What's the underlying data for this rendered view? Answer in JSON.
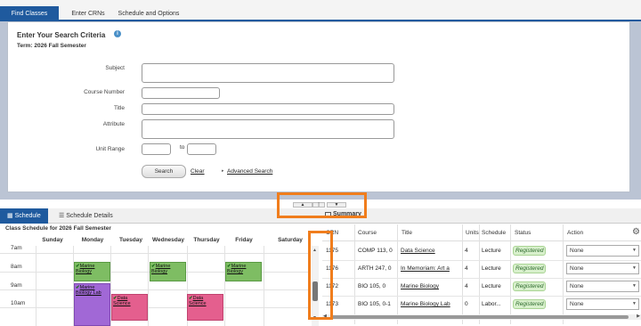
{
  "tabs": [
    "Find Classes",
    "Enter CRNs",
    "Schedule and Options"
  ],
  "search": {
    "title": "Enter Your Search Criteria",
    "info_icon": "info-icon",
    "term": "Term: 2026 Fall Semester",
    "labels": {
      "subject": "Subject",
      "course_number": "Course Number",
      "title": "Title",
      "attribute": "Attribute",
      "unit_range": "Unit Range",
      "to": "to"
    },
    "values": {
      "subject": "",
      "course_number": "",
      "title": "",
      "attribute": "",
      "unit_from": "",
      "unit_to": ""
    },
    "search_button": "Search",
    "clear_link": "Clear",
    "advanced_link": "Advanced Search"
  },
  "splitter": {
    "up": "▲",
    "mid": "|",
    "down": "▼"
  },
  "schedule": {
    "tab_schedule": "Schedule",
    "tab_details": "Schedule Details",
    "calendar_title": "Class Schedule for 2026 Fall Semester",
    "days": [
      "Sunday",
      "Monday",
      "Tuesday",
      "Wednesday",
      "Thursday",
      "Friday",
      "Saturday"
    ],
    "times": [
      "7am",
      "8am",
      "9am",
      "10am"
    ],
    "events": [
      {
        "label": "Marine Biology",
        "color": "green"
      },
      {
        "label": "Marine Biology",
        "color": "green"
      },
      {
        "label": "Marine Biology",
        "color": "green"
      },
      {
        "label": "Marine Biology Lab",
        "color": "purple"
      },
      {
        "label": "Data Science",
        "color": "pink"
      },
      {
        "label": "Data Science",
        "color": "pink"
      }
    ]
  },
  "summary": {
    "tab": "Summary",
    "headers": [
      "CRN",
      "Course",
      "Title",
      "Units",
      "Schedule",
      "Status",
      "Action"
    ],
    "rows": [
      {
        "crn": "1175",
        "course": "COMP 113, 0",
        "title": "Data Science",
        "units": "4",
        "schedule": "Lecture",
        "status": "Registered",
        "action": "None"
      },
      {
        "crn": "1176",
        "course": "ARTH 247, 0",
        "title": "In Memoriam: Art a",
        "units": "4",
        "schedule": "Lecture",
        "status": "Registered",
        "action": "None"
      },
      {
        "crn": "1172",
        "course": "BIO 105, 0",
        "title": "Marine Biology",
        "units": "4",
        "schedule": "Lecture",
        "status": "Registered",
        "action": "None"
      },
      {
        "crn": "1173",
        "course": "BIO 105, 0-1",
        "title": "Marine Biology Lab",
        "units": "0",
        "schedule": "Labor...",
        "status": "Registered",
        "action": "None"
      }
    ]
  },
  "colors": {
    "accent": "#1f5a9e",
    "highlight": "#f07d1c",
    "registered_bg": "#d8f0cc"
  }
}
